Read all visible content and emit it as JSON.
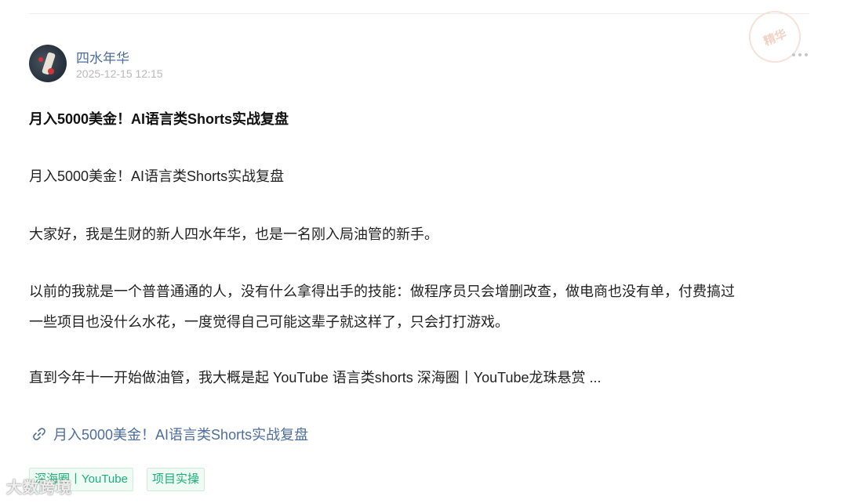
{
  "post": {
    "author": "四水年华",
    "timestamp": "2025-12-15 12:15",
    "stamp_text": "精华",
    "title": "月入5000美金！AI语言类Shorts实战复盘",
    "paragraphs": [
      "月入5000美金！AI语言类Shorts实战复盘",
      "大家好，我是生财的新人四水年华，也是一名刚入局油管的新手。",
      "以前的我就是一个普普通通的人，没有什么拿得出手的技能：做程序员只会增删改查，做电商也没有单，付费搞过",
      "一些项目也没什么水花，一度觉得自己可能这辈子就这样了，只会打打游戏。",
      "直到今年十一开始做油管，我大概是起 YouTube 语言类shorts  深海圈丨YouTube龙珠悬赏  ..."
    ],
    "link_text": "月入5000美金！AI语言类Shorts实战复盘",
    "tags": [
      "深海圈丨YouTube",
      "项目实操"
    ]
  },
  "watermark": "大数跨境",
  "icons": {
    "more": "more-dots-icon",
    "link": "link-icon"
  },
  "colors": {
    "author": "#4d6d9a",
    "tag_text": "#1aae7a",
    "tag_bg": "#f1fbf5"
  }
}
